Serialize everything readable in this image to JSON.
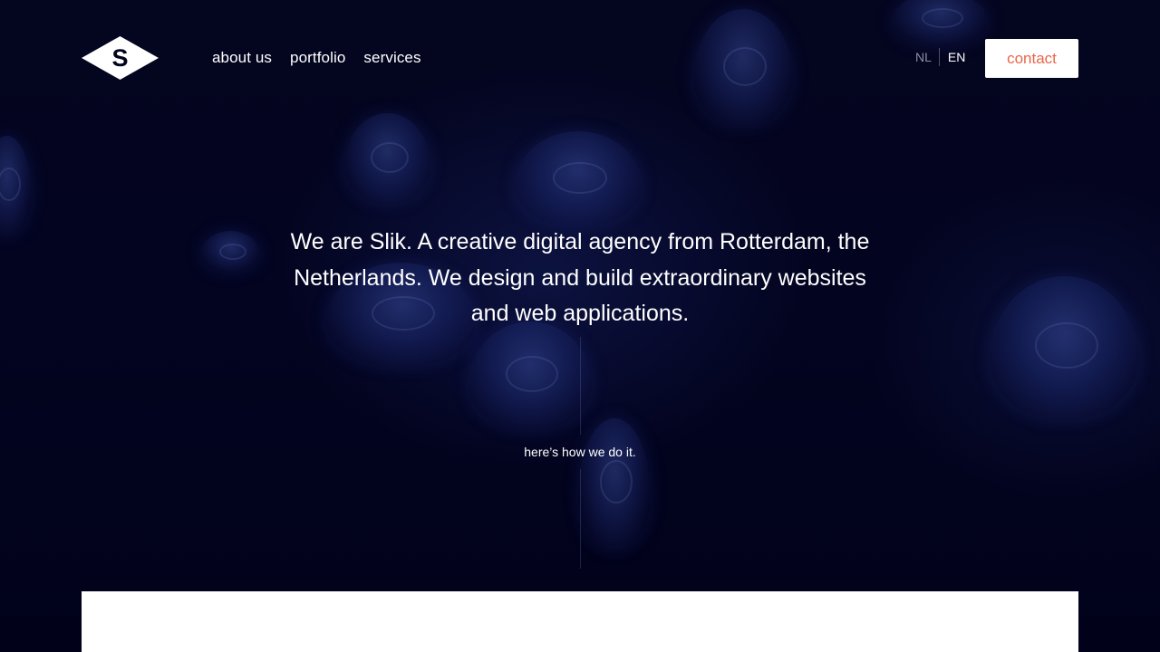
{
  "brand": {
    "logo_letter": "S",
    "logo_icon": "diamond-s-logo-icon"
  },
  "nav": {
    "items": [
      {
        "label": "about us"
      },
      {
        "label": "portfolio"
      },
      {
        "label": "services"
      }
    ]
  },
  "language": {
    "options": [
      {
        "label": "NL",
        "active": false
      },
      {
        "label": "EN",
        "active": true
      }
    ]
  },
  "header": {
    "contact_label": "contact"
  },
  "hero": {
    "intro_text": "We are Slik. A creative digital agency from Rotterdam, the Netherlands. We design and build extraordinary websites and web applications.",
    "cta_label": "here’s how we do it."
  },
  "colors": {
    "background": "#02031c",
    "accent": "#e8674a",
    "text": "#ffffff",
    "inactive_lang": "#8a8fa6"
  }
}
